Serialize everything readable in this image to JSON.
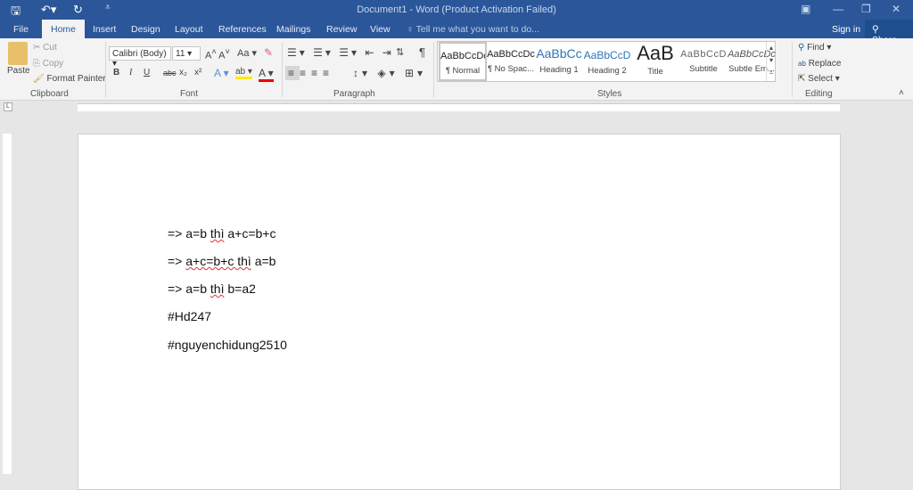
{
  "titlebar": {
    "title": "Document1 - Word (Product Activation Failed)",
    "save_icon": "save-icon",
    "undo_icon": "undo-icon",
    "redo_icon": "redo-icon"
  },
  "tabs": [
    "File",
    "Home",
    "Insert",
    "Design",
    "Layout",
    "References",
    "Mailings",
    "Review",
    "View"
  ],
  "tell_me": "Tell me what you want to do...",
  "sign_in": "Sign in",
  "share": "Share",
  "clipboard": {
    "paste": "Paste",
    "cut": "Cut",
    "copy": "Copy",
    "format_painter": "Format Painter",
    "label": "Clipboard"
  },
  "font": {
    "name": "Calibri (Body)",
    "size": "11",
    "label": "Font",
    "case": "Aa",
    "bold": "B",
    "italic": "I",
    "underline": "U",
    "strike": "abc",
    "sub": "x₂",
    "sup": "x²"
  },
  "paragraph": {
    "label": "Paragraph",
    "pilcrow": "¶"
  },
  "styles": {
    "label": "Styles",
    "items": [
      {
        "preview": "AaBbCcDc",
        "name": "¶ Normal"
      },
      {
        "preview": "AaBbCcDc",
        "name": "¶ No Spac..."
      },
      {
        "preview": "AaBbCc",
        "name": "Heading 1"
      },
      {
        "preview": "AaBbCcD",
        "name": "Heading 2"
      },
      {
        "preview": "AaB",
        "name": "Title"
      },
      {
        "preview": "AaBbCcD",
        "name": "Subtitle"
      },
      {
        "preview": "AaBbCcDc",
        "name": "Subtle Em..."
      }
    ]
  },
  "editing": {
    "label": "Editing",
    "find": "Find",
    "replace": "Replace",
    "select": "Select"
  },
  "document": {
    "lines": [
      [
        "=> a=b ",
        "thì",
        " a+c=b+c"
      ],
      [
        "=> ",
        "a+c=b+c thì",
        " a=b"
      ],
      [
        "=> a=b ",
        "thì",
        " b=a2"
      ],
      [
        "#Hd247",
        "",
        ""
      ],
      [
        "#nguyenchidung2510",
        "",
        ""
      ]
    ]
  }
}
